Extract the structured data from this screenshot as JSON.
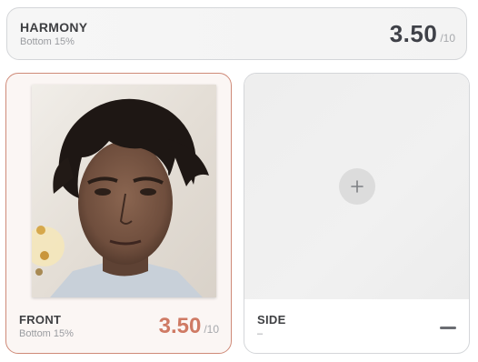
{
  "harmony": {
    "label": "HARMONY",
    "percentile": "Bottom 15%",
    "score": "3.50",
    "out_of": "/10"
  },
  "front": {
    "label": "FRONT",
    "percentile": "Bottom 15%",
    "score": "3.50",
    "out_of": "/10"
  },
  "side": {
    "label": "SIDE",
    "percentile": "–",
    "add_icon": "plus-icon",
    "empty_score_icon": "minus-icon"
  },
  "colors": {
    "accent": "#cf7a64",
    "front_border": "#cf8a78",
    "card_border": "#d4d6d9"
  }
}
